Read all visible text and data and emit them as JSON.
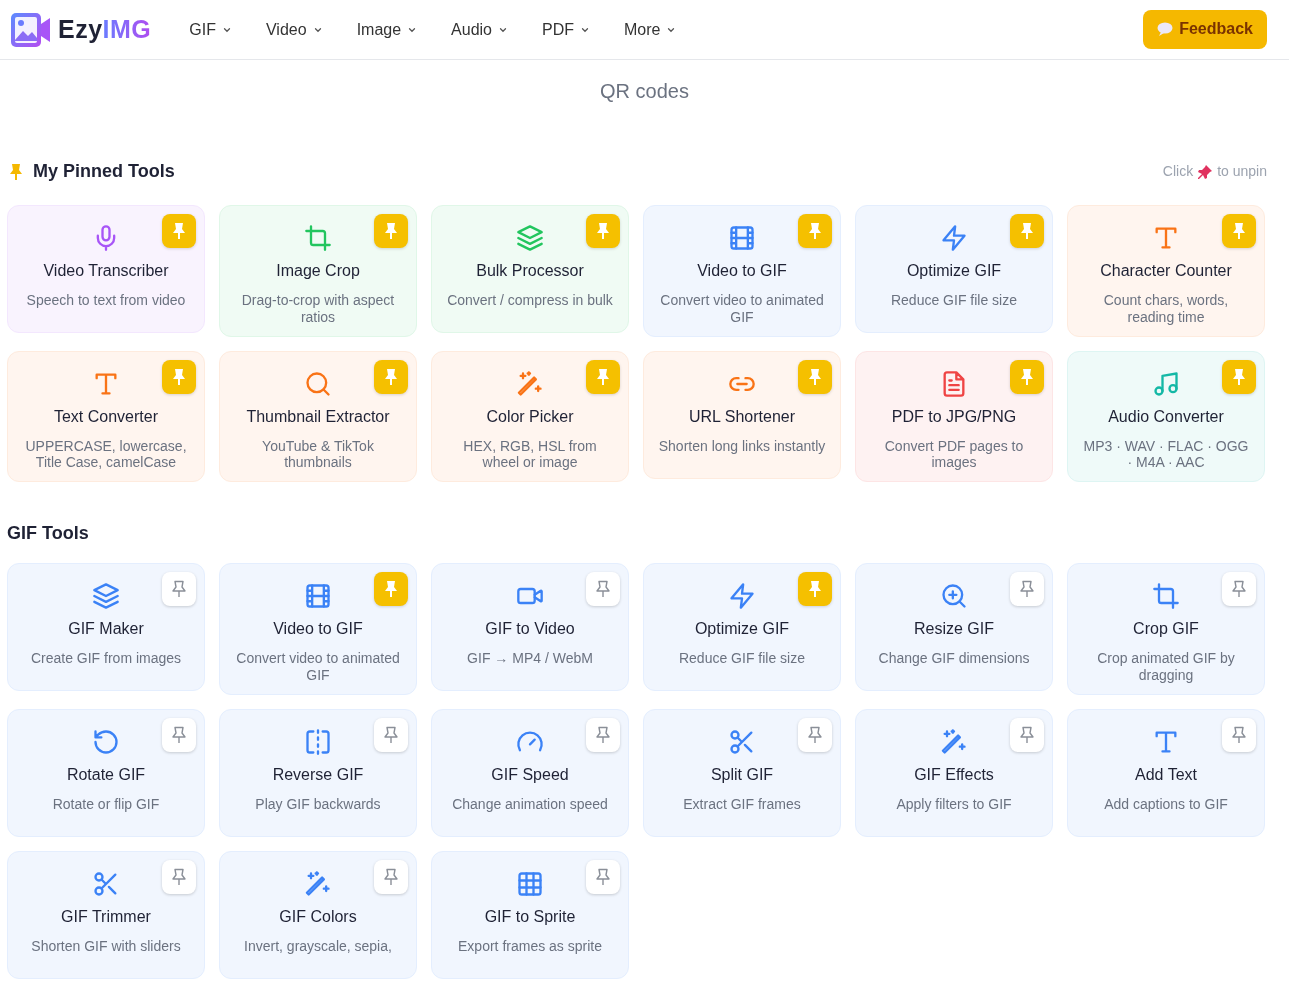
{
  "brand": {
    "part_1": "Ezy",
    "part_2": "IMG"
  },
  "nav": [
    {
      "label": "GIF"
    },
    {
      "label": "Video"
    },
    {
      "label": "Image"
    },
    {
      "label": "Audio"
    },
    {
      "label": "PDF"
    },
    {
      "label": "More"
    }
  ],
  "feedback_button": {
    "label": "Feedback"
  },
  "hero": {
    "subtitle": "QR codes"
  },
  "pinned_section": {
    "title": "My Pinned Tools",
    "hint_before": "Click",
    "hint_after": "to unpin",
    "tools": [
      {
        "kind": "mic",
        "color": "#a855f7",
        "title": "Video Transcriber",
        "description": "Speech to text from video",
        "pinned": true
      },
      {
        "kind": "crop",
        "color": "#22c55e",
        "title": "Image Crop",
        "description": "Drag-to-crop with aspect ratios",
        "pinned": true
      },
      {
        "kind": "layers",
        "color": "#22c55e",
        "title": "Bulk Processor",
        "description": "Convert / compress in bulk",
        "pinned": true
      },
      {
        "kind": "film",
        "color": "#3b82f6",
        "title": "Video to GIF",
        "description": "Convert video to animated GIF",
        "pinned": true
      },
      {
        "kind": "bolt",
        "color": "#3b82f6",
        "title": "Optimize GIF",
        "description": "Reduce GIF file size",
        "pinned": true
      },
      {
        "kind": "type",
        "color": "#f97316",
        "title": "Character Counter",
        "description": "Count chars, words, reading time",
        "pinned": true
      },
      {
        "kind": "type",
        "color": "#f97316",
        "title": "Text Converter",
        "description": "UPPERCASE, lowercase, Title Case, camelCase",
        "pinned": true
      },
      {
        "kind": "search",
        "color": "#f97316",
        "title": "Thumbnail Extractor",
        "description": "YouTube & TikTok thumbnails",
        "pinned": true
      },
      {
        "kind": "wand",
        "color": "#f97316",
        "title": "Color Picker",
        "description": "HEX, RGB, HSL from wheel or image",
        "pinned": true
      },
      {
        "kind": "link",
        "color": "#f97316",
        "title": "URL Shortener",
        "description": "Shorten long links instantly",
        "pinned": true
      },
      {
        "kind": "file",
        "color": "#ef4444",
        "title": "PDF to JPG/PNG",
        "description": "Convert PDF pages to images",
        "pinned": true
      },
      {
        "kind": "music",
        "color": "#14b8a6",
        "title": "Audio Converter",
        "description": "MP3 · WAV · FLAC · OGG · M4A · AAC",
        "pinned": true
      }
    ]
  },
  "gif_section": {
    "title": "GIF Tools",
    "tools": [
      {
        "kind": "layers",
        "color": "#3b82f6",
        "title": "GIF Maker",
        "description": "Create GIF from images",
        "pinned": false
      },
      {
        "kind": "film",
        "color": "#3b82f6",
        "title": "Video to GIF",
        "description": "Convert video to animated GIF",
        "pinned": true
      },
      {
        "kind": "video",
        "color": "#3b82f6",
        "title": "GIF to Video",
        "description": "GIF → MP4 / WebM",
        "pinned": false
      },
      {
        "kind": "bolt",
        "color": "#3b82f6",
        "title": "Optimize GIF",
        "description": "Reduce GIF file size",
        "pinned": true
      },
      {
        "kind": "zoom",
        "color": "#3b82f6",
        "title": "Resize GIF",
        "description": "Change GIF dimensions",
        "pinned": false
      },
      {
        "kind": "crop",
        "color": "#3b82f6",
        "title": "Crop GIF",
        "description": "Crop animated GIF by dragging",
        "pinned": false
      },
      {
        "kind": "rotate",
        "color": "#3b82f6",
        "title": "Rotate GIF",
        "description": "Rotate or flip GIF",
        "pinned": false
      },
      {
        "kind": "flip",
        "color": "#3b82f6",
        "title": "Reverse GIF",
        "description": "Play GIF backwards",
        "pinned": false
      },
      {
        "kind": "gauge",
        "color": "#3b82f6",
        "title": "GIF Speed",
        "description": "Change animation speed",
        "pinned": false
      },
      {
        "kind": "scissors",
        "color": "#3b82f6",
        "title": "Split GIF",
        "description": "Extract GIF frames",
        "pinned": false
      },
      {
        "kind": "wand",
        "color": "#3b82f6",
        "title": "GIF Effects",
        "description": "Apply filters to GIF",
        "pinned": false
      },
      {
        "kind": "type",
        "color": "#3b82f6",
        "title": "Add Text",
        "description": "Add captions to GIF",
        "pinned": false
      },
      {
        "kind": "scissors",
        "color": "#3b82f6",
        "title": "GIF Trimmer",
        "description": "Shorten GIF with sliders",
        "pinned": false
      },
      {
        "kind": "wand",
        "color": "#3b82f6",
        "title": "GIF Colors",
        "description": "Invert, grayscale, sepia,",
        "pinned": false
      },
      {
        "kind": "grid",
        "color": "#3b82f6",
        "title": "GIF to Sprite",
        "description": "Export frames as sprite",
        "pinned": false
      }
    ]
  }
}
